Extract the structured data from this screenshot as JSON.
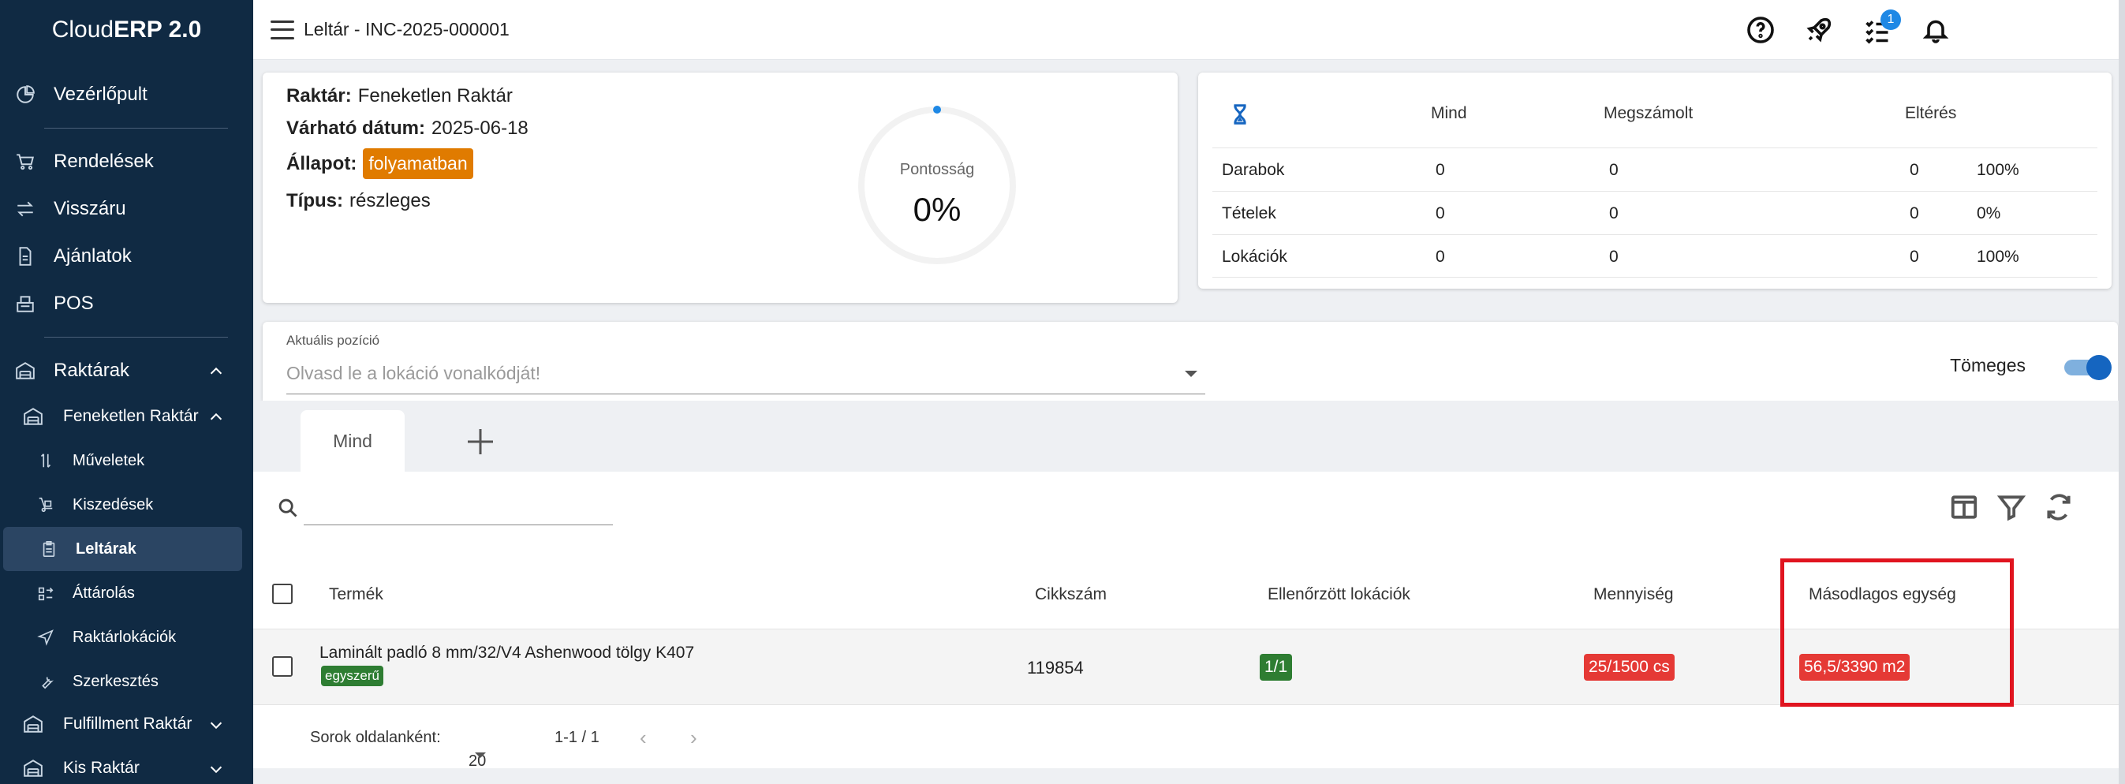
{
  "app": {
    "brand_light": "Cloud",
    "brand_bold": "ERP 2.0"
  },
  "sidebar": {
    "items": [
      {
        "label": "Vezérlőpult",
        "icon": "dashboard-icon"
      },
      {
        "label": "Rendelések",
        "icon": "cart-icon"
      },
      {
        "label": "Visszáru",
        "icon": "swap-icon"
      },
      {
        "label": "Ajánlatok",
        "icon": "document-icon"
      },
      {
        "label": "POS",
        "icon": "register-icon"
      },
      {
        "label": "Raktárak",
        "icon": "warehouse-icon"
      },
      {
        "label": "Feneketlen Raktár",
        "icon": "warehouse-icon"
      },
      {
        "label": "Műveletek",
        "icon": "arrows-vertical-icon"
      },
      {
        "label": "Kiszedések",
        "icon": "dolly-icon"
      },
      {
        "label": "Leltárak",
        "icon": "clipboard-icon"
      },
      {
        "label": "Áttárolás",
        "icon": "transfer-icon"
      },
      {
        "label": "Raktárlokációk",
        "icon": "location-arrow-icon"
      },
      {
        "label": "Szerkesztés",
        "icon": "wrench-icon"
      },
      {
        "label": "Fulfillment Raktár",
        "icon": "warehouse-icon"
      },
      {
        "label": "Kis Raktár",
        "icon": "warehouse-icon"
      }
    ]
  },
  "header": {
    "title": "Leltár - INC-2025-000001",
    "notification_count": "1"
  },
  "info": {
    "warehouse_label": "Raktár:",
    "warehouse_value": "Feneketlen Raktár",
    "date_label": "Várható dátum:",
    "date_value": "2025-06-18",
    "status_label": "Állapot:",
    "status_value": "folyamatban",
    "type_label": "Típus:",
    "type_value": "részleges",
    "gauge_label": "Pontosság",
    "gauge_value": "0%",
    "gauge_fraction": 0
  },
  "stats": {
    "headers": [
      "Mind",
      "Megszámolt",
      "Eltérés"
    ],
    "rows": [
      {
        "label": "Darabok",
        "all": "0",
        "counted": "0",
        "diff": "0",
        "pct": "100%"
      },
      {
        "label": "Tételek",
        "all": "0",
        "counted": "0",
        "diff": "0",
        "pct": "0%"
      },
      {
        "label": "Lokációk",
        "all": "0",
        "counted": "0",
        "diff": "0",
        "pct": "100%"
      }
    ]
  },
  "location": {
    "label": "Aktuális pozíció",
    "placeholder": "Olvasd le a lokáció vonalkódját!",
    "bulk_label": "Tömeges",
    "bulk_on": true
  },
  "tabs": [
    {
      "label": "Mind"
    }
  ],
  "table": {
    "columns": [
      "Termék",
      "Cikkszám",
      "Ellenőrzött lokációk",
      "Mennyiség",
      "Másodlagos egység"
    ],
    "rows": [
      {
        "product": "Laminált padló 8 mm/32/V4 Ashenwood tölgy K407",
        "tag": "egyszerű",
        "sku": "119854",
        "locations": "1/1",
        "quantity": "25/1500 cs",
        "secondary": "56,5/3390 m2"
      }
    ],
    "footer": {
      "rows_per_page_label": "Sorok oldalanként:",
      "rows_per_page": "20",
      "range": "1-1 / 1"
    }
  },
  "colors": {
    "sidebar": "#102a43",
    "status_chip": "#e07b00",
    "green": "#2e7d32",
    "red": "#e53935",
    "accent": "#1e88e5",
    "highlight": "#e0141f"
  }
}
